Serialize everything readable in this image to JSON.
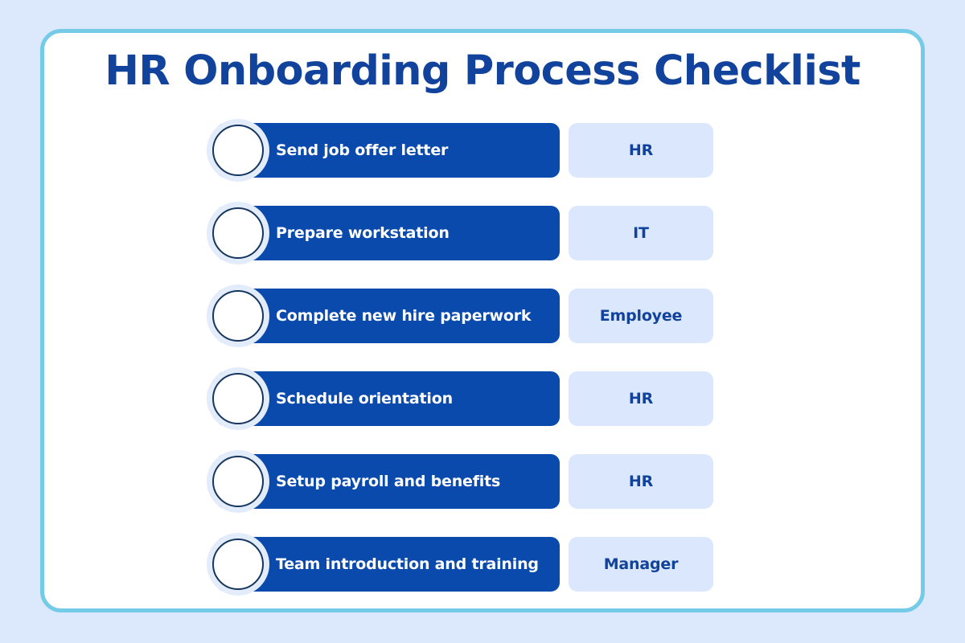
{
  "theme": {
    "page_background": "#dce8fc",
    "card_background": "#ffffff",
    "card_border": "#74cbe8",
    "title_color": "#11439c",
    "task_bar_color": "#0a4aad",
    "task_label_color": "#ffffff",
    "badge_background": "#dbe7fc",
    "badge_text_color": "#11439c",
    "checkbox_fill": "#ffffff",
    "checkbox_border": "#16365f",
    "checkbox_halo": "#e3ecfb"
  },
  "header": {
    "title": "HR Onboarding Process Checklist"
  },
  "checklist": {
    "items": [
      {
        "checkbox": "",
        "task": "Send job offer letter",
        "role": "HR",
        "checked": false
      },
      {
        "checkbox": "",
        "task": "Prepare workstation",
        "role": "IT",
        "checked": false
      },
      {
        "checkbox": "",
        "task": "Complete new hire paperwork",
        "role": "Employee",
        "checked": false
      },
      {
        "checkbox": "",
        "task": "Schedule orientation",
        "role": "HR",
        "checked": false
      },
      {
        "checkbox": "",
        "task": "Setup payroll and benefits",
        "role": "HR",
        "checked": false
      },
      {
        "checkbox": "",
        "task": "Team introduction and training",
        "role": "Manager",
        "checked": false
      }
    ]
  }
}
